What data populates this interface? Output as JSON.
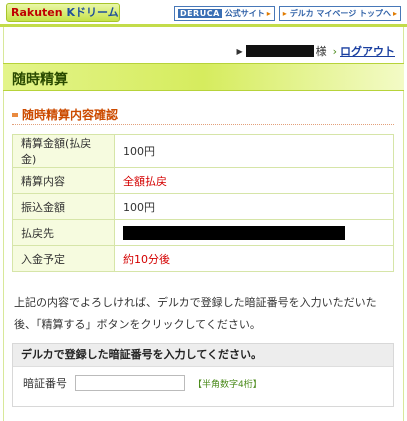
{
  "header": {
    "logo_brand": "Rakuten",
    "logo_sub": "Kドリームス",
    "deru_logo": "DERUCA",
    "official_site": "公式サイト",
    "deruca_mypage": "デルカ マイページ トップへ"
  },
  "userline": {
    "honorific": "様",
    "logout": "ログアウト"
  },
  "page": {
    "title": "随時精算"
  },
  "section": {
    "heading": "随時精算内容確認"
  },
  "details": {
    "rows": [
      {
        "label": "精算金額(払戻金)",
        "value": "100円"
      },
      {
        "label": "精算内容",
        "value": "全額払戻"
      },
      {
        "label": "振込金額",
        "value": "100円"
      },
      {
        "label": "払戻先",
        "value": ""
      },
      {
        "label": "入金予定",
        "value": "約10分後"
      }
    ]
  },
  "notice": {
    "text": "上記の内容でよろしければ、デルカで登録した暗証番号を入力いただいた後、「精算する」ボタンをクリックしてください。"
  },
  "pin": {
    "heading": "デルカで登録した暗証番号を入力してください。",
    "label": "暗証番号",
    "value": "",
    "hint": "【半角数字4桁】"
  },
  "colors": {
    "accent_green": "#c3dc4a",
    "heading_orange": "#cc4b00",
    "alert_red": "#d40000",
    "link_blue": "#1a3fa0"
  }
}
